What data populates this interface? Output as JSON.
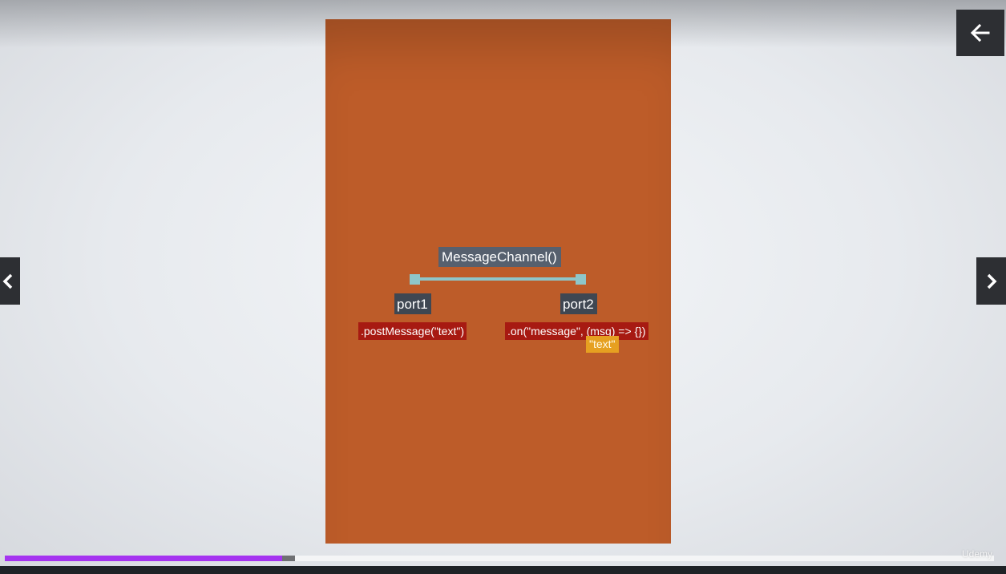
{
  "slide": {
    "channel_label": "MessageChannel()",
    "port1_label": "port1",
    "port2_label": "port2",
    "post_message_code": ".postMessage(\"text\")",
    "on_message_code": ".on(\"message\", (msg) => {})",
    "text_badge": "\"text\""
  },
  "controls": {
    "back_icon": "arrow-left-icon",
    "prev_icon": "chevron-left-icon",
    "next_icon": "chevron-right-icon"
  },
  "progress": {
    "played_fraction": 0.28,
    "buffered_fraction": 0.293,
    "fill_color": "#a534f0"
  },
  "watermark": {
    "text": "Udemy"
  },
  "colors": {
    "slide_background": "#bd5c29",
    "code_label_background": "#a71a12",
    "badge_background": "#e6a021",
    "channel_line": "#8ec6c9"
  }
}
